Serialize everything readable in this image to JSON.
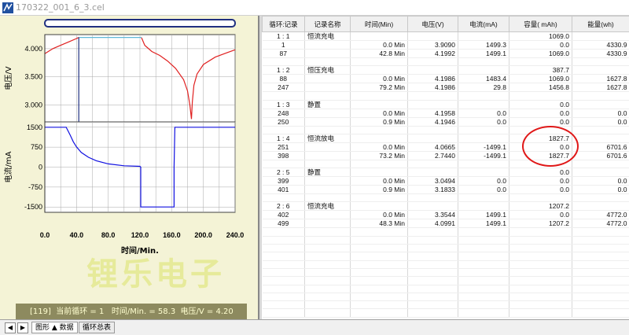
{
  "window": {
    "title": "170322_001_6_3.cel"
  },
  "status": {
    "text": "[119]  当前循环 = 1   时间/Min. = 58.3  电压/V = 4.20"
  },
  "watermark": "锂乐电子",
  "tabs": [
    {
      "label": "图形 ▲ 数据"
    },
    {
      "label": "循环总表"
    }
  ],
  "table": {
    "columns": [
      "循环:记录",
      "记录名称",
      "时间(Min)",
      "电压(V)",
      "电流(mA)",
      "容量( mAh)",
      "能量(wh)"
    ],
    "rows": [
      [
        "1 : 1",
        "恒流充电",
        "",
        "",
        "",
        "1069.0",
        ""
      ],
      [
        "1",
        "",
        "0.0 Min",
        "3.9090",
        "1499.3",
        "0.0",
        "4330.9"
      ],
      [
        "87",
        "",
        "42.8 Min",
        "4.1992",
        "1499.1",
        "1069.0",
        "4330.9"
      ],
      [
        "",
        "",
        "",
        "",
        "",
        "",
        ""
      ],
      [
        "1 : 2",
        "恒压充电",
        "",
        "",
        "",
        "387.7",
        ""
      ],
      [
        "88",
        "",
        "0.0 Min",
        "4.1986",
        "1483.4",
        "1069.0",
        "1627.8"
      ],
      [
        "247",
        "",
        "79.2 Min",
        "4.1986",
        "29.8",
        "1456.8",
        "1627.8"
      ],
      [
        "",
        "",
        "",
        "",
        "",
        "",
        ""
      ],
      [
        "1 : 3",
        "静置",
        "",
        "",
        "",
        "0.0",
        ""
      ],
      [
        "248",
        "",
        "0.0 Min",
        "4.1958",
        "0.0",
        "0.0",
        "0.0"
      ],
      [
        "250",
        "",
        "0.9 Min",
        "4.1946",
        "0.0",
        "0.0",
        "0.0"
      ],
      [
        "",
        "",
        "",
        "",
        "",
        "",
        ""
      ],
      [
        "1 : 4",
        "恒流放电",
        "",
        "",
        "",
        "1827.7",
        ""
      ],
      [
        "251",
        "",
        "0.0 Min",
        "4.0665",
        "-1499.1",
        "0.0",
        "6701.6"
      ],
      [
        "398",
        "",
        "73.2 Min",
        "2.7440",
        "-1499.1",
        "1827.7",
        "6701.6"
      ],
      [
        "",
        "",
        "",
        "",
        "",
        "",
        ""
      ],
      [
        "2 : 5",
        "静置",
        "",
        "",
        "",
        "0.0",
        ""
      ],
      [
        "399",
        "",
        "0.0 Min",
        "3.0494",
        "0.0",
        "0.0",
        "0.0"
      ],
      [
        "401",
        "",
        "0.9 Min",
        "3.1833",
        "0.0",
        "0.0",
        "0.0"
      ],
      [
        "",
        "",
        "",
        "",
        "",
        "",
        ""
      ],
      [
        "2 : 6",
        "恒流充电",
        "",
        "",
        "",
        "1207.2",
        ""
      ],
      [
        "402",
        "",
        "0.0 Min",
        "3.3544",
        "1499.1",
        "0.0",
        "4772.0"
      ],
      [
        "499",
        "",
        "48.3 Min",
        "4.0991",
        "1499.1",
        "1207.2",
        "4772.0"
      ],
      [
        "",
        "",
        "",
        "",
        "",
        "",
        ""
      ],
      [
        "",
        "",
        "",
        "",
        "",
        "",
        ""
      ],
      [
        "",
        "",
        "",
        "",
        "",
        "",
        ""
      ],
      [
        "",
        "",
        "",
        "",
        "",
        "",
        ""
      ],
      [
        "",
        "",
        "",
        "",
        "",
        "",
        ""
      ],
      [
        "",
        "",
        "",
        "",
        "",
        "",
        ""
      ],
      [
        "",
        "",
        "",
        "",
        "",
        "",
        ""
      ],
      [
        "",
        "",
        "",
        "",
        "",
        "",
        ""
      ],
      [
        "",
        "",
        "",
        "",
        "",
        "",
        ""
      ],
      [
        "",
        "",
        "",
        "",
        "",
        "",
        ""
      ],
      [
        "",
        "",
        "",
        "",
        "",
        "",
        ""
      ]
    ]
  },
  "chart_data": [
    {
      "type": "line",
      "ylabel": "电压/V",
      "yticks": [
        "4.000",
        "3.500",
        "3.000"
      ],
      "ylim": [
        2.7,
        4.25
      ],
      "xlim": [
        0,
        240
      ],
      "grid": true,
      "series": [
        {
          "color": "#e02020",
          "x": [
            0,
            10,
            20,
            30,
            40,
            42.8
          ],
          "y": [
            3.91,
            4.0,
            4.06,
            4.12,
            4.18,
            4.2
          ]
        },
        {
          "color": "#5fb8d8",
          "x": [
            42.8,
            122
          ],
          "y": [
            4.2,
            4.2
          ]
        },
        {
          "color": "#e02020",
          "x": [
            122,
            126,
            135,
            145,
            155,
            165,
            175,
            180,
            183,
            185,
            186,
            188,
            192,
            200,
            215,
            230,
            240
          ],
          "y": [
            4.195,
            4.06,
            3.95,
            3.88,
            3.78,
            3.65,
            3.45,
            3.25,
            3.0,
            2.75,
            3.05,
            3.35,
            3.55,
            3.72,
            3.85,
            3.93,
            3.98
          ]
        },
        {
          "color": "#203080",
          "x": [
            42.8,
            42.8
          ],
          "y": [
            4.2,
            2.7
          ]
        }
      ]
    },
    {
      "type": "line",
      "ylabel": "电流/mA",
      "xlabel": "时间/Min.",
      "yticks": [
        "1500",
        "750",
        "0",
        "-750",
        "-1500"
      ],
      "xticks": [
        "0.0",
        "40.0",
        "80.0",
        "120.0",
        "160.0",
        "200.0",
        "240.0"
      ],
      "ylim": [
        -1700,
        1700
      ],
      "xlim": [
        0,
        240
      ],
      "grid": true,
      "series": [
        {
          "color": "#1010e0",
          "x": [
            0,
            27,
            32,
            36,
            40,
            46,
            55,
            65,
            80,
            100,
            120,
            121,
            121,
            163,
            163,
            164,
            240
          ],
          "y": [
            1500,
            1500,
            1200,
            950,
            760,
            550,
            370,
            240,
            120,
            50,
            30,
            0,
            -1500,
            -1500,
            0,
            1500,
            1500
          ]
        }
      ]
    }
  ]
}
